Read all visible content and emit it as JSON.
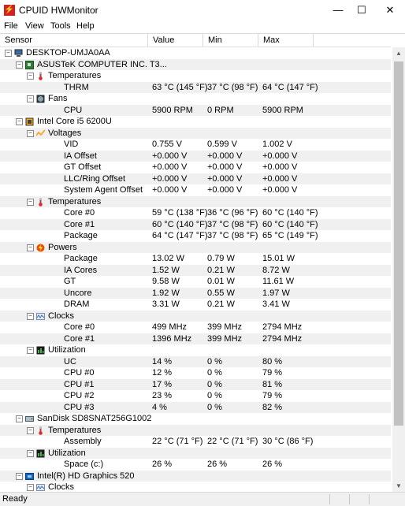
{
  "window": {
    "title": "CPUID HWMonitor",
    "min_glyph": "—",
    "max_glyph": "☐",
    "close_glyph": "✕"
  },
  "menu": [
    "File",
    "View",
    "Tools",
    "Help"
  ],
  "columns": {
    "sensor": "Sensor",
    "value": "Value",
    "min": "Min",
    "max": "Max"
  },
  "rows": [
    {
      "level": 0,
      "icon": "computer-icon",
      "label": "DESKTOP-UMJA0AA",
      "value": "",
      "min": "",
      "max": ""
    },
    {
      "level": 1,
      "icon": "motherboard-icon",
      "label": "ASUSTeK COMPUTER INC. T3...",
      "value": "",
      "min": "",
      "max": ""
    },
    {
      "level": 2,
      "icon": "thermometer-icon",
      "label": "Temperatures",
      "value": "",
      "min": "",
      "max": ""
    },
    {
      "level": 3,
      "icon": "",
      "label": "THRM",
      "value": "63 °C  (145 °F)",
      "min": "37 °C  (98 °F)",
      "max": "64 °C  (147 °F)"
    },
    {
      "level": 2,
      "icon": "fan-icon",
      "label": "Fans",
      "value": "",
      "min": "",
      "max": ""
    },
    {
      "level": 3,
      "icon": "",
      "label": "CPU",
      "value": "5900 RPM",
      "min": "0 RPM",
      "max": "5900 RPM"
    },
    {
      "level": 1,
      "icon": "cpu-chip-icon",
      "label": "Intel Core i5 6200U",
      "value": "",
      "min": "",
      "max": ""
    },
    {
      "level": 2,
      "icon": "voltage-icon",
      "label": "Voltages",
      "value": "",
      "min": "",
      "max": ""
    },
    {
      "level": 3,
      "icon": "",
      "label": "VID",
      "value": "0.755 V",
      "min": "0.599 V",
      "max": "1.002 V"
    },
    {
      "level": 3,
      "icon": "",
      "label": "IA Offset",
      "value": "+0.000 V",
      "min": "+0.000 V",
      "max": "+0.000 V"
    },
    {
      "level": 3,
      "icon": "",
      "label": "GT Offset",
      "value": "+0.000 V",
      "min": "+0.000 V",
      "max": "+0.000 V"
    },
    {
      "level": 3,
      "icon": "",
      "label": "LLC/Ring Offset",
      "value": "+0.000 V",
      "min": "+0.000 V",
      "max": "+0.000 V"
    },
    {
      "level": 3,
      "icon": "",
      "label": "System Agent Offset",
      "value": "+0.000 V",
      "min": "+0.000 V",
      "max": "+0.000 V"
    },
    {
      "level": 2,
      "icon": "thermometer-icon",
      "label": "Temperatures",
      "value": "",
      "min": "",
      "max": ""
    },
    {
      "level": 3,
      "icon": "",
      "label": "Core #0",
      "value": "59 °C  (138 °F)",
      "min": "36 °C  (96 °F)",
      "max": "60 °C  (140 °F)"
    },
    {
      "level": 3,
      "icon": "",
      "label": "Core #1",
      "value": "60 °C  (140 °F)",
      "min": "37 °C  (98 °F)",
      "max": "60 °C  (140 °F)"
    },
    {
      "level": 3,
      "icon": "",
      "label": "Package",
      "value": "64 °C  (147 °F)",
      "min": "37 °C  (98 °F)",
      "max": "65 °C  (149 °F)"
    },
    {
      "level": 2,
      "icon": "power-icon",
      "label": "Powers",
      "value": "",
      "min": "",
      "max": ""
    },
    {
      "level": 3,
      "icon": "",
      "label": "Package",
      "value": "13.02 W",
      "min": "0.79 W",
      "max": "15.01 W"
    },
    {
      "level": 3,
      "icon": "",
      "label": "IA Cores",
      "value": "1.52 W",
      "min": "0.21 W",
      "max": "8.72 W"
    },
    {
      "level": 3,
      "icon": "",
      "label": "GT",
      "value": "9.58 W",
      "min": "0.01 W",
      "max": "11.61 W"
    },
    {
      "level": 3,
      "icon": "",
      "label": "Uncore",
      "value": "1.92 W",
      "min": "0.55 W",
      "max": "1.97 W"
    },
    {
      "level": 3,
      "icon": "",
      "label": "DRAM",
      "value": "3.31 W",
      "min": "0.21 W",
      "max": "3.41 W"
    },
    {
      "level": 2,
      "icon": "clock-icon",
      "label": "Clocks",
      "value": "",
      "min": "",
      "max": ""
    },
    {
      "level": 3,
      "icon": "",
      "label": "Core #0",
      "value": "499 MHz",
      "min": "399 MHz",
      "max": "2794 MHz"
    },
    {
      "level": 3,
      "icon": "",
      "label": "Core #1",
      "value": "1396 MHz",
      "min": "399 MHz",
      "max": "2794 MHz"
    },
    {
      "level": 2,
      "icon": "utilization-icon",
      "label": "Utilization",
      "value": "",
      "min": "",
      "max": ""
    },
    {
      "level": 3,
      "icon": "",
      "label": "UC",
      "value": "14 %",
      "min": "0 %",
      "max": "80 %"
    },
    {
      "level": 3,
      "icon": "",
      "label": "CPU #0",
      "value": "12 %",
      "min": "0 %",
      "max": "79 %"
    },
    {
      "level": 3,
      "icon": "",
      "label": "CPU #1",
      "value": "17 %",
      "min": "0 %",
      "max": "81 %"
    },
    {
      "level": 3,
      "icon": "",
      "label": "CPU #2",
      "value": "23 %",
      "min": "0 %",
      "max": "79 %"
    },
    {
      "level": 3,
      "icon": "",
      "label": "CPU #3",
      "value": "4 %",
      "min": "0 %",
      "max": "82 %"
    },
    {
      "level": 1,
      "icon": "disk-icon",
      "label": "SanDisk SD8SNAT256G1002",
      "value": "",
      "min": "",
      "max": ""
    },
    {
      "level": 2,
      "icon": "thermometer-icon",
      "label": "Temperatures",
      "value": "",
      "min": "",
      "max": ""
    },
    {
      "level": 3,
      "icon": "",
      "label": "Assembly",
      "value": "22 °C  (71 °F)",
      "min": "22 °C  (71 °F)",
      "max": "30 °C  (86 °F)"
    },
    {
      "level": 2,
      "icon": "utilization-icon",
      "label": "Utilization",
      "value": "",
      "min": "",
      "max": ""
    },
    {
      "level": 3,
      "icon": "",
      "label": "Space (c:)",
      "value": "26 %",
      "min": "26 %",
      "max": "26 %"
    },
    {
      "level": 1,
      "icon": "gpu-icon",
      "label": "Intel(R) HD Graphics 520",
      "value": "",
      "min": "",
      "max": ""
    },
    {
      "level": 2,
      "icon": "clock-icon",
      "label": "Clocks",
      "value": "",
      "min": "",
      "max": ""
    }
  ],
  "status": {
    "text": "Ready"
  }
}
